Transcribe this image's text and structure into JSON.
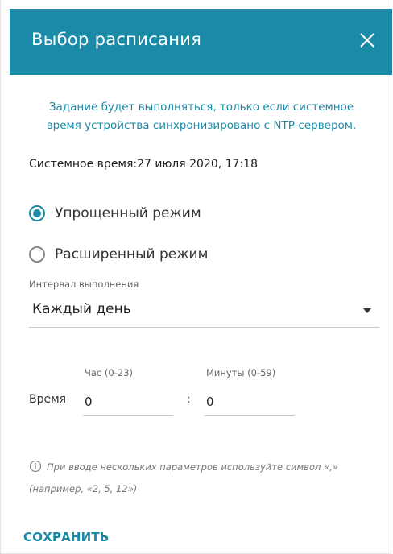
{
  "dialog": {
    "title": "Выбор расписания",
    "close_icon": "close-icon",
    "accent_color": "#1a8aa6"
  },
  "info": {
    "line1": "Задание будет выполняться, только если системное",
    "line2": "время устройства синхронизировано с NTP-сервером."
  },
  "system_time": {
    "text": "Системное время:27 июля 2020, 17:18"
  },
  "mode": {
    "options": [
      {
        "label": "Упрощенный режим",
        "checked": true
      },
      {
        "label": "Расширенный режим",
        "checked": false
      }
    ]
  },
  "interval": {
    "label": "Интервал выполнения",
    "value": "Каждый день"
  },
  "time": {
    "label": "Время",
    "hour_label": "Час (0-23)",
    "hour_value": "0",
    "separator": ":",
    "minute_label": "Минуты (0-59)",
    "minute_value": "0"
  },
  "hint": {
    "icon": "info-icon",
    "text": "При вводе нескольких параметров используйте символ «,» (например, «2, 5, 12»)"
  },
  "actions": {
    "save_label": "СОХРАНИТЬ"
  }
}
